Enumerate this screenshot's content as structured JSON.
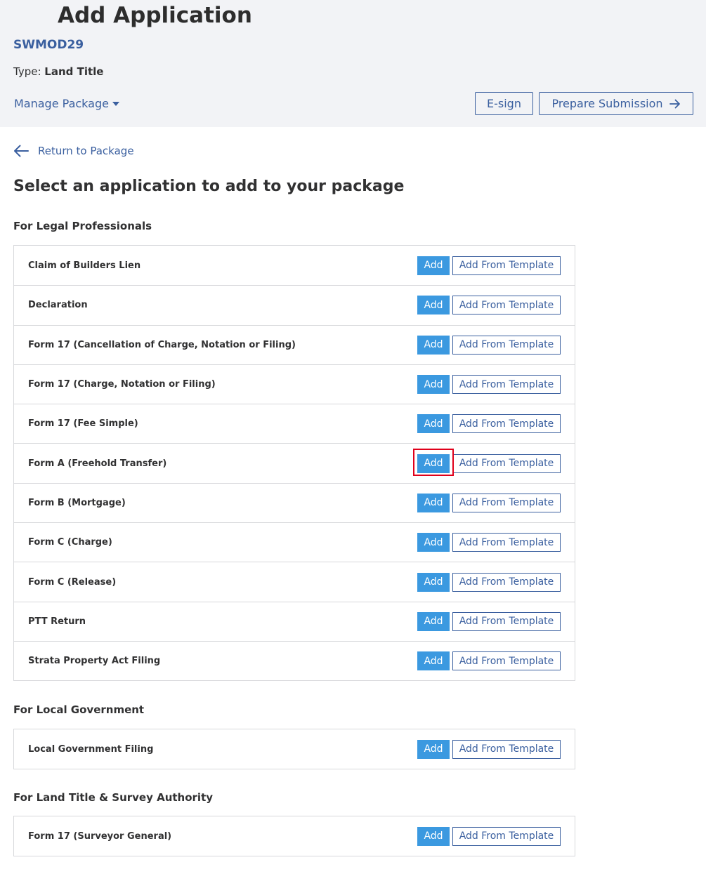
{
  "header": {
    "title": "Add Application",
    "package_name": "SWMOD29",
    "type_label": "Type:",
    "type_value": "Land Title",
    "manage_package": "Manage Package",
    "esign": "E-sign",
    "prepare_submission": "Prepare Submission"
  },
  "nav": {
    "return_to_package": "Return to Package"
  },
  "main": {
    "heading": "Select an application to add to your package",
    "add_label": "Add",
    "template_label": "Add From Template",
    "groups": [
      {
        "title": "For Legal Professionals",
        "apps": [
          "Claim of Builders Lien",
          "Declaration",
          "Form 17 (Cancellation of Charge, Notation or Filing)",
          "Form 17 (Charge, Notation or Filing)",
          "Form 17 (Fee Simple)",
          "Form A (Freehold Transfer)",
          "Form B (Mortgage)",
          "Form C (Charge)",
          "Form C (Release)",
          "PTT Return",
          "Strata Property Act Filing"
        ]
      },
      {
        "title": "For Local Government",
        "apps": [
          "Local Government Filing"
        ]
      },
      {
        "title": "For Land Title & Survey Authority",
        "apps": [
          "Form 17 (Surveyor General)"
        ]
      }
    ]
  }
}
